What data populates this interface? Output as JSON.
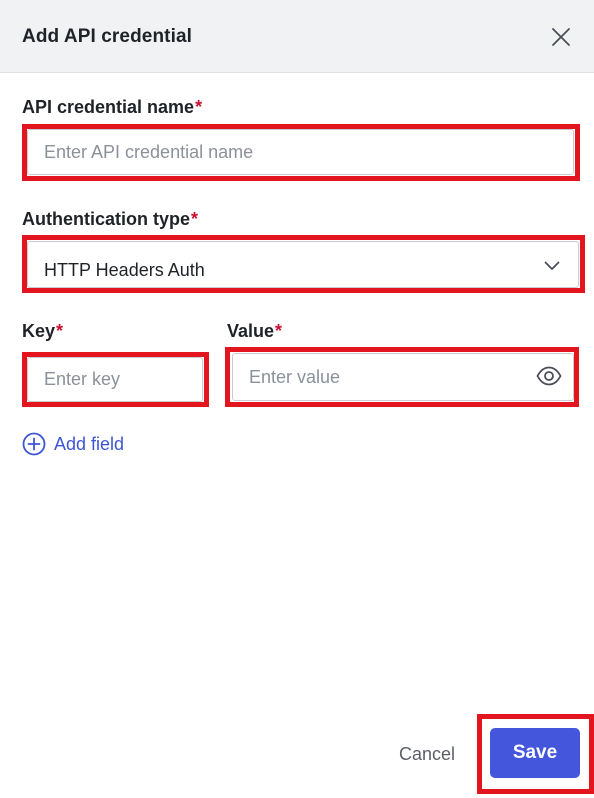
{
  "dialog": {
    "title": "Add API credential"
  },
  "fields": {
    "name": {
      "label": "API credential name",
      "required_mark": "*",
      "value": "",
      "placeholder": "Enter API credential name"
    },
    "auth_type": {
      "label": "Authentication type",
      "required_mark": "*",
      "selected": "HTTP Headers Auth"
    },
    "key": {
      "label": "Key",
      "required_mark": "*",
      "value": "",
      "placeholder": "Enter key"
    },
    "value": {
      "label": "Value",
      "required_mark": "*",
      "value": "",
      "placeholder": "Enter value"
    }
  },
  "add_field": {
    "label": "Add field"
  },
  "footer": {
    "cancel_label": "Cancel",
    "save_label": "Save"
  },
  "icons": {
    "close": "close-icon",
    "chevron": "chevron-down-icon",
    "eye": "eye-icon",
    "add": "plus-circle-icon"
  },
  "colors": {
    "primary": "#4457dc",
    "link": "#3d56d6",
    "required": "#c8102e",
    "highlight": "#e3161f",
    "header_bg": "#f1f2f4"
  }
}
